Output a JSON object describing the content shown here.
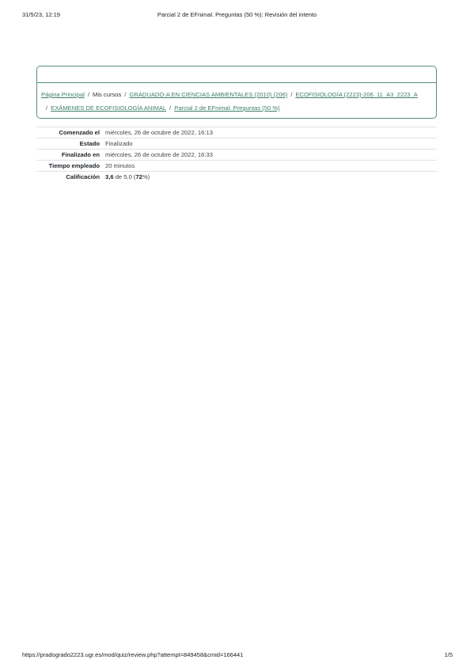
{
  "print_header": {
    "datetime": "31/5/23, 12:19",
    "title": "Parcial 2 de EFnimal. Preguntas (50 %): Revisión del intento"
  },
  "breadcrumb": {
    "items": [
      {
        "label": "Página Principal",
        "link": true
      },
      {
        "label": "Mis cursos",
        "link": false
      },
      {
        "label": "GRADUADO-A EN CIENCIAS AMBIENTALES (2010) (206)",
        "link": true
      },
      {
        "label": "ECOFISIOLOGÍA (2223)-206_11_A3_2223_A",
        "link": true
      },
      {
        "label": "EXÁMENES DE ECOFISIOLOGÍA ANIMAL",
        "link": true
      },
      {
        "label": "Parcial 2 de EFnimal. Preguntas (50 %)",
        "link": true
      }
    ],
    "separator": "/"
  },
  "summary": {
    "rows": [
      {
        "label": "Comenzado el",
        "value": "miércoles, 26 de octubre de 2022, 16:13"
      },
      {
        "label": "Estado",
        "value": "Finalizado"
      },
      {
        "label": "Finalizado en",
        "value": "miércoles, 26 de octubre de 2022, 16:33"
      },
      {
        "label": "Tiempo empleado",
        "value": "20 minutos"
      }
    ],
    "grade": {
      "label": "Calificación",
      "score": "3,6",
      "of_text": "de 5,0 (",
      "percent": "72",
      "suffix": "%)"
    }
  },
  "print_footer": {
    "url": "https://pradogrado2223.ugr.es/mod/quiz/review.php?attempt=849458&cmid=166441",
    "page": "1/5"
  }
}
